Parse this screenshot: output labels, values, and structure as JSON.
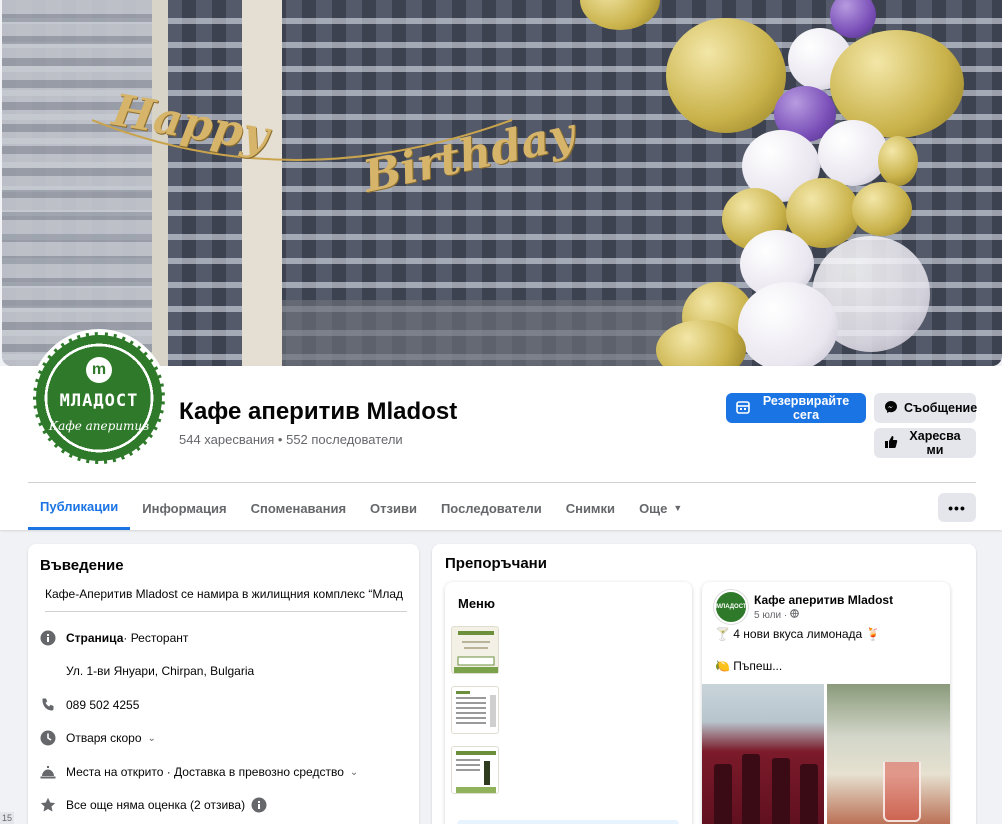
{
  "page": {
    "name": "Кафе аперитив Mladost",
    "stats": "544 харесвания • 552 последователи",
    "avatar": {
      "title": "МЛАДОСТ",
      "subtitle": "Кафе аперитив",
      "mark": "m"
    },
    "cover": {
      "banner_left": "Happy",
      "banner_right": "Birthday"
    }
  },
  "actions": {
    "reserve": "Резервирайте сега",
    "message": "Съобщение",
    "like": "Харесва ми"
  },
  "tabs": [
    {
      "label": "Публикации",
      "active": true
    },
    {
      "label": "Информация"
    },
    {
      "label": "Споменавания"
    },
    {
      "label": "Отзиви"
    },
    {
      "label": "Последователи"
    },
    {
      "label": "Снимки"
    },
    {
      "label": "Още"
    }
  ],
  "more_button": "•••",
  "intro": {
    "title": "Въведение",
    "description": "Кафе-Аперитив Mladost се намира в жилищния комплекс “Млад",
    "page_label": "Страница",
    "page_category": " · Ресторант",
    "address": "Ул. 1-ви Януари, Chirpan, Bulgaria",
    "phone": "089 502 4255",
    "hours": "Отваря скоро",
    "services": "Места на открито · Доставка в превозно средство",
    "rating": "Все още няма оценка (2 отзива)"
  },
  "recommended": {
    "title": "Препоръчани",
    "menu_title": "Меню",
    "menu_thumb_text": "Младост",
    "post": {
      "author": "Кафе аперитив Mladost",
      "date": "5 юли · ",
      "line1": "🍸 4 нови вкуса лимонада 🍹",
      "line2": "🍋 Пъпеш..."
    }
  },
  "corner_badge": "15",
  "colors": {
    "accent": "#1b74e4",
    "brand_green": "#2f7a2a",
    "muted": "#65676b"
  }
}
